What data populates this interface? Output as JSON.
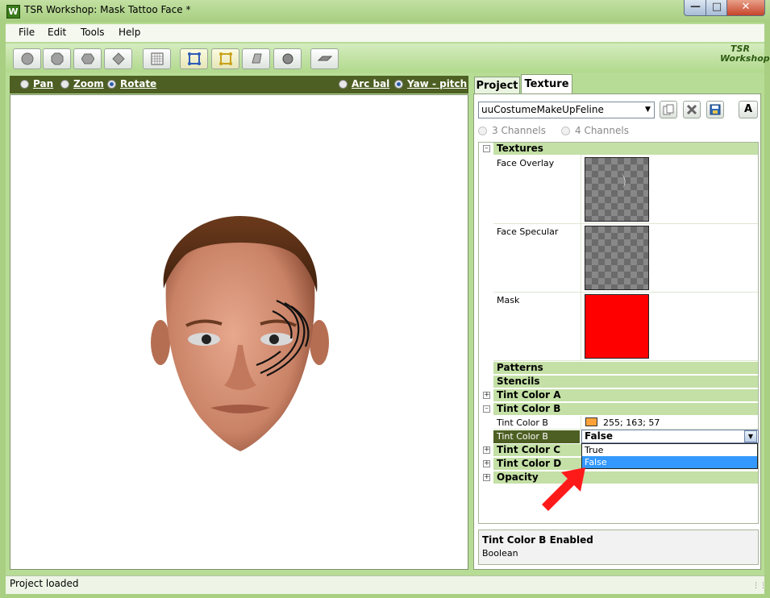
{
  "window": {
    "title": "TSR Workshop: Mask Tattoo Face *",
    "icon_letter": "W"
  },
  "menu": [
    "File",
    "Edit",
    "Tools",
    "Help"
  ],
  "toolbar": {
    "buttons": [
      "sphere-icon",
      "octagon-icon",
      "hexagon-icon",
      "diamond-icon",
      "grid-icon",
      "bones-blue-icon",
      "bones-yellow-icon",
      "plane-icon",
      "shaded-sphere-icon",
      "floor-icon"
    ],
    "logo_line1": "TSR",
    "logo_line2": "Workshop"
  },
  "viewport": {
    "modes": [
      {
        "label": "Pan",
        "selected": false
      },
      {
        "label": "Zoom",
        "selected": false
      },
      {
        "label": "Rotate",
        "selected": true
      }
    ],
    "rotation": [
      {
        "label": "Arc bal",
        "selected": false
      },
      {
        "label": "Yaw - pitch",
        "selected": true
      }
    ]
  },
  "tabs": {
    "project": "Project",
    "texture": "Texture",
    "active": "Texture"
  },
  "texture_select": {
    "value": "uuCostumeMakeUpFeline"
  },
  "font_button": "A",
  "channels": [
    {
      "label": "3 Channels",
      "selected": false
    },
    {
      "label": "4 Channels",
      "selected": false
    }
  ],
  "grid": {
    "textures": {
      "label": "Textures",
      "face_overlay": "Face Overlay",
      "face_specular": "Face Specular",
      "mask": "Mask",
      "mask_color": "#ff0000"
    },
    "patterns": "Patterns",
    "stencils": "Stencils",
    "tint_a": "Tint Color A",
    "tint_b": {
      "label": "Tint Color B",
      "color_label": "Tint Color B",
      "color_value": "255; 163; 57",
      "color_hex": "#ffa339",
      "enabled_label": "Tint Color B Enabled",
      "enabled_value": "False"
    },
    "dropdown_options": [
      "True",
      "False"
    ],
    "tint_c": "Tint Color C",
    "tint_d": "Tint Color D",
    "opacity": "Opacity"
  },
  "description": {
    "title": "Tint Color B Enabled",
    "text": "Boolean"
  },
  "status": {
    "text": "Project loaded"
  }
}
